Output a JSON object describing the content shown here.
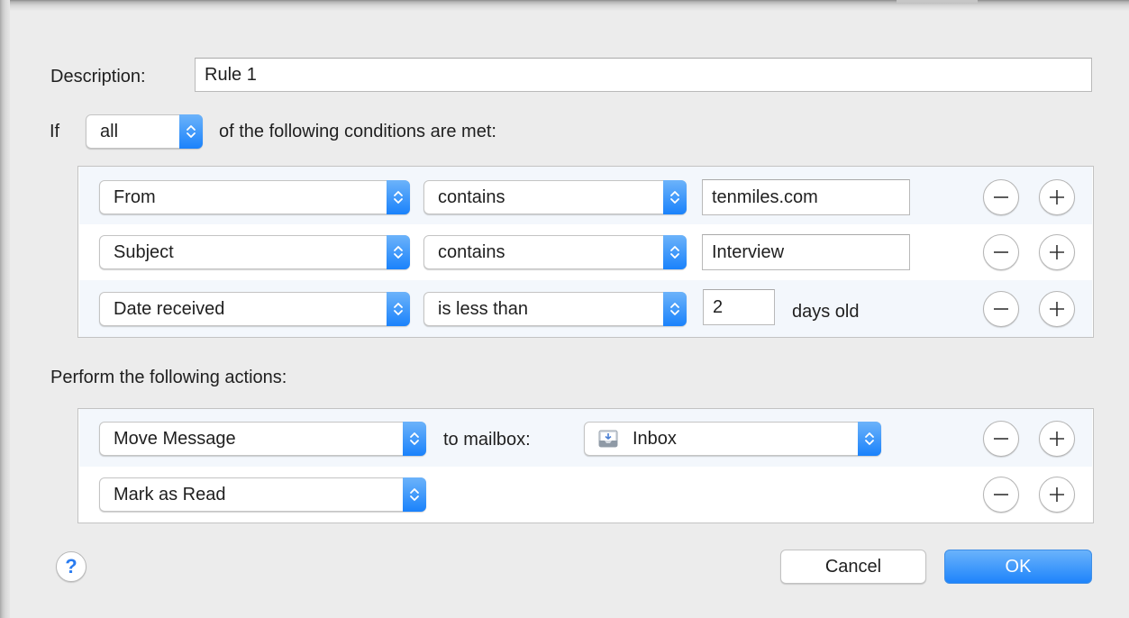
{
  "description": {
    "label": "Description:",
    "value": "Rule 1"
  },
  "conditions_header": {
    "prefix": "If",
    "match_select": "all",
    "suffix": "of the following conditions are met:"
  },
  "conditions": [
    {
      "field": "From",
      "operator": "contains",
      "value": "tenmiles.com",
      "suffix": ""
    },
    {
      "field": "Subject",
      "operator": "contains",
      "value": "Interview",
      "suffix": ""
    },
    {
      "field": "Date received",
      "operator": "is less than",
      "value": "2",
      "suffix": "days old"
    }
  ],
  "actions_header": "Perform the following actions:",
  "actions": [
    {
      "action": "Move Message",
      "connector": "to mailbox:",
      "target": "Inbox",
      "target_icon": "mailbox-inbox-icon"
    },
    {
      "action": "Mark as Read"
    }
  ],
  "buttons": {
    "help": "?",
    "cancel": "Cancel",
    "ok": "OK"
  },
  "colors": {
    "accent": "#1e84fb",
    "row_alternate": "#f3f7fc",
    "background": "#ececec"
  }
}
